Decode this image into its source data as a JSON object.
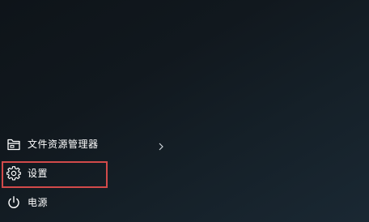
{
  "start_menu": {
    "items": [
      {
        "label": "文件资源管理器",
        "icon": "folder-icon",
        "has_submenu": true
      },
      {
        "label": "设置",
        "icon": "gear-icon",
        "highlighted": true
      },
      {
        "label": "电源",
        "icon": "power-icon"
      }
    ],
    "highlight_color": "#d24a4a"
  }
}
